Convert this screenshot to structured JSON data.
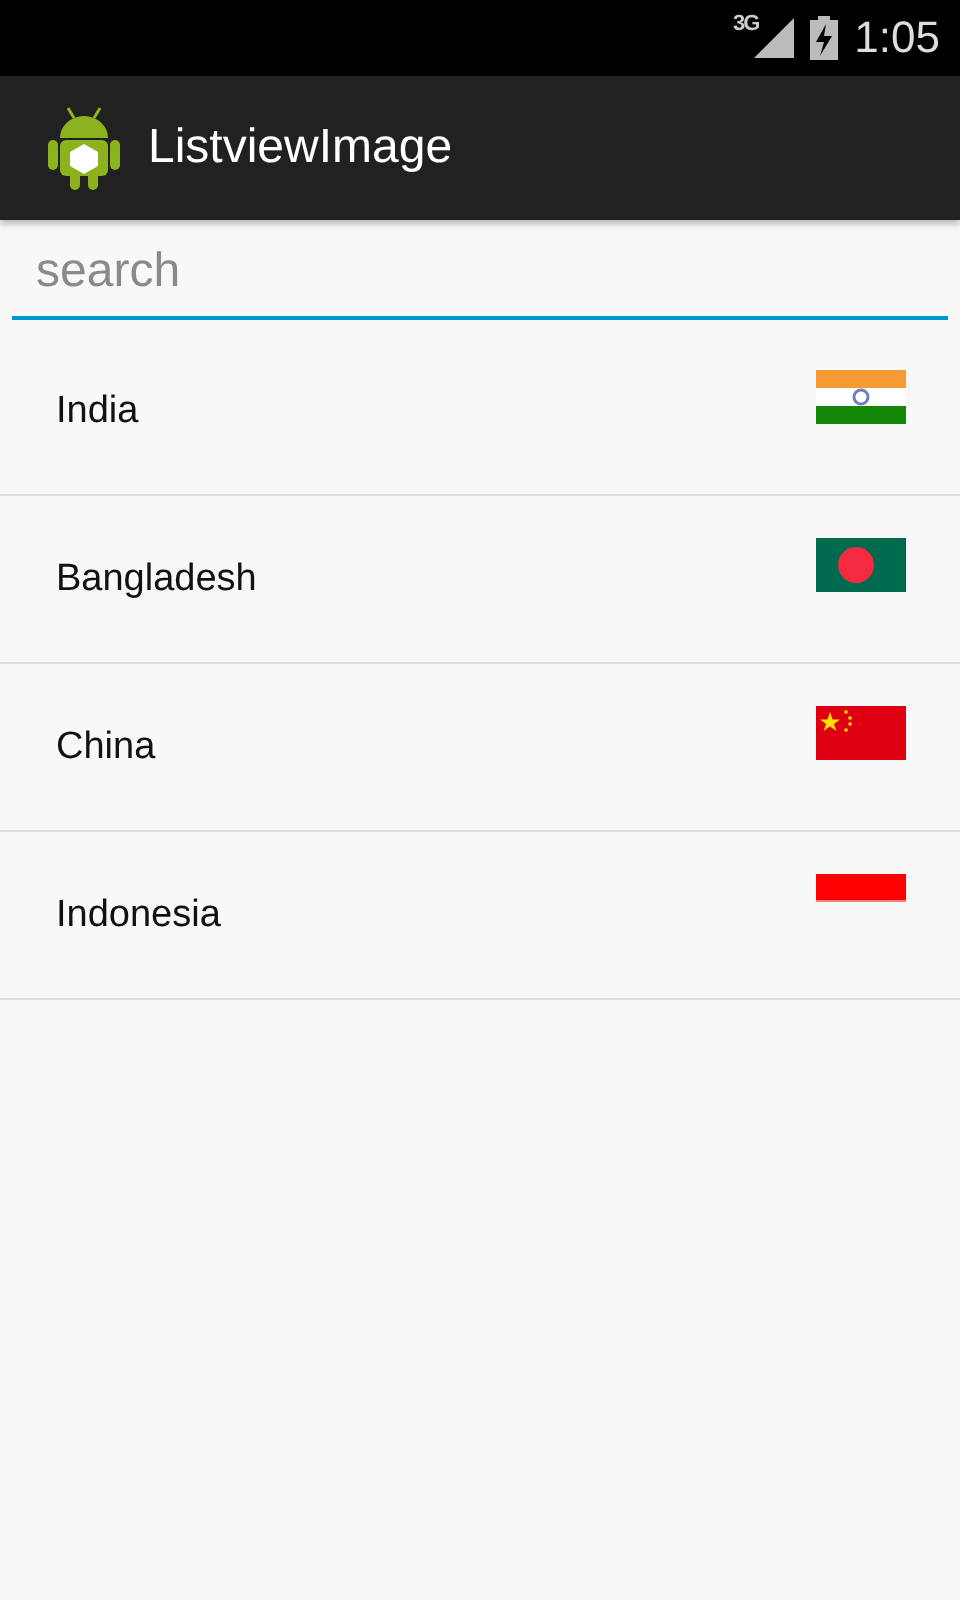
{
  "status_bar": {
    "network": "3G",
    "time": "1:05"
  },
  "app_bar": {
    "title": "ListviewImage"
  },
  "search": {
    "placeholder": "search"
  },
  "countries": [
    {
      "name": "India",
      "kind": "india"
    },
    {
      "name": "Bangladesh",
      "kind": "bangladesh"
    },
    {
      "name": "China",
      "kind": "china"
    },
    {
      "name": "Indonesia",
      "kind": "indonesia"
    }
  ]
}
